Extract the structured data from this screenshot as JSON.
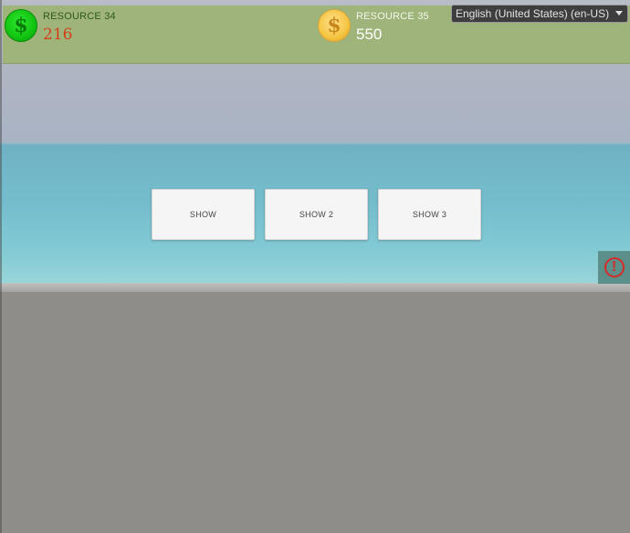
{
  "resources": [
    {
      "label": "RESOURCE 34",
      "value": "216",
      "icon": "green-dollar-coin-icon"
    },
    {
      "label": "RESOURCE 35",
      "value": "550",
      "icon": "gold-dollar-coin-icon"
    }
  ],
  "coin_symbol": "$",
  "language": {
    "selected": "English (United States) (en-US)"
  },
  "buttons": {
    "show": "SHOW",
    "show2": "SHOW 2",
    "show3": "SHOW 3"
  },
  "alert": {
    "symbol": "!"
  },
  "colors": {
    "top_bar": "#9fb47a",
    "resource1_value": "#d2421a",
    "green_coin": "#11c411",
    "gold_coin": "#f5c542",
    "alert_bg": "#5d8f8a",
    "alert_icon": "#d42a2a"
  }
}
